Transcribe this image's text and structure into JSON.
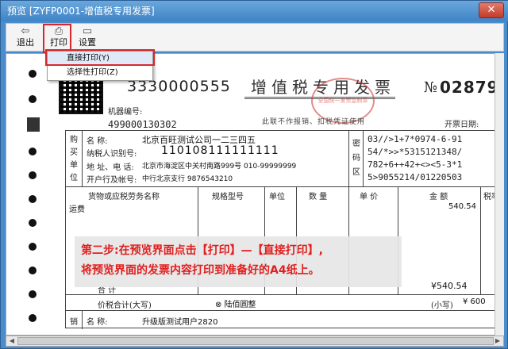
{
  "window": {
    "title": "预览 [ZYFP0001-增值税专用发票]",
    "close_label": "✕"
  },
  "toolbar": {
    "exit_label": "退出",
    "print_label": "打印",
    "settings_label": "设置"
  },
  "print_menu": {
    "items": [
      {
        "label": "直接打印(Y)"
      },
      {
        "label": "选择性打印(Z)"
      }
    ]
  },
  "invoice": {
    "code": "3330000555",
    "machine_label": "机器编号:",
    "machine_no": "499000130302",
    "title": "增值税专用发票",
    "subtitle": "此联不作报销、扣税凭证使用",
    "no_symbol": "№",
    "no_value": "02879",
    "date_label": "开票日期:",
    "seal_text": "全国统一发票监制章",
    "buyer": {
      "side_label": [
        "购",
        "买",
        "单",
        "位"
      ],
      "name_label": "名    称:",
      "name_value": "北京百旺测试公司一二三四五",
      "tax_label": "纳税人识别号:",
      "tax_value": "110108111111111",
      "addr_label": "地 址、电 话:",
      "addr_value": "北京市海淀区中关村南路999号 010-99999999",
      "bank_label": "开户行及帐号:",
      "bank_value": "中行北京支行 9876543210"
    },
    "cipher_label": [
      "密",
      "码",
      "区"
    ],
    "cipher_lines": [
      "03//>1+7*0974-6-91",
      "54/*>>*5315121348/",
      "782+6++42+<><5-3*1",
      "5>9055214/01220503"
    ],
    "columns": {
      "goods": "货物或应税劳务名称",
      "spec": "规格型号",
      "unit": "单位",
      "qty": "数 量",
      "price": "单 价",
      "amount": "金 额",
      "tax_rate": "税率"
    },
    "line_item": {
      "name": "运费",
      "amount": "540.54"
    },
    "total_label": "合          计",
    "total_amount": "¥540.54",
    "total_words_label": "价税合计(大写)",
    "total_words_value": "⊗ 陆佰圆整",
    "total_small_label": "(小写)",
    "total_small_value": "¥ 600",
    "seller_side": "销",
    "seller_name_label": "名  称:",
    "seller_name_value": "升级版测试用户2820"
  },
  "instruction": {
    "line1": "第二步:在预览界面点击【打印】—【直接打印】,",
    "line2": "将预览界面的发票内容打印到准备好的A4纸上。"
  },
  "colors": {
    "title_bar": "#4a8ccc",
    "highlight": "#d62828",
    "instruction_text": "#e02020"
  }
}
